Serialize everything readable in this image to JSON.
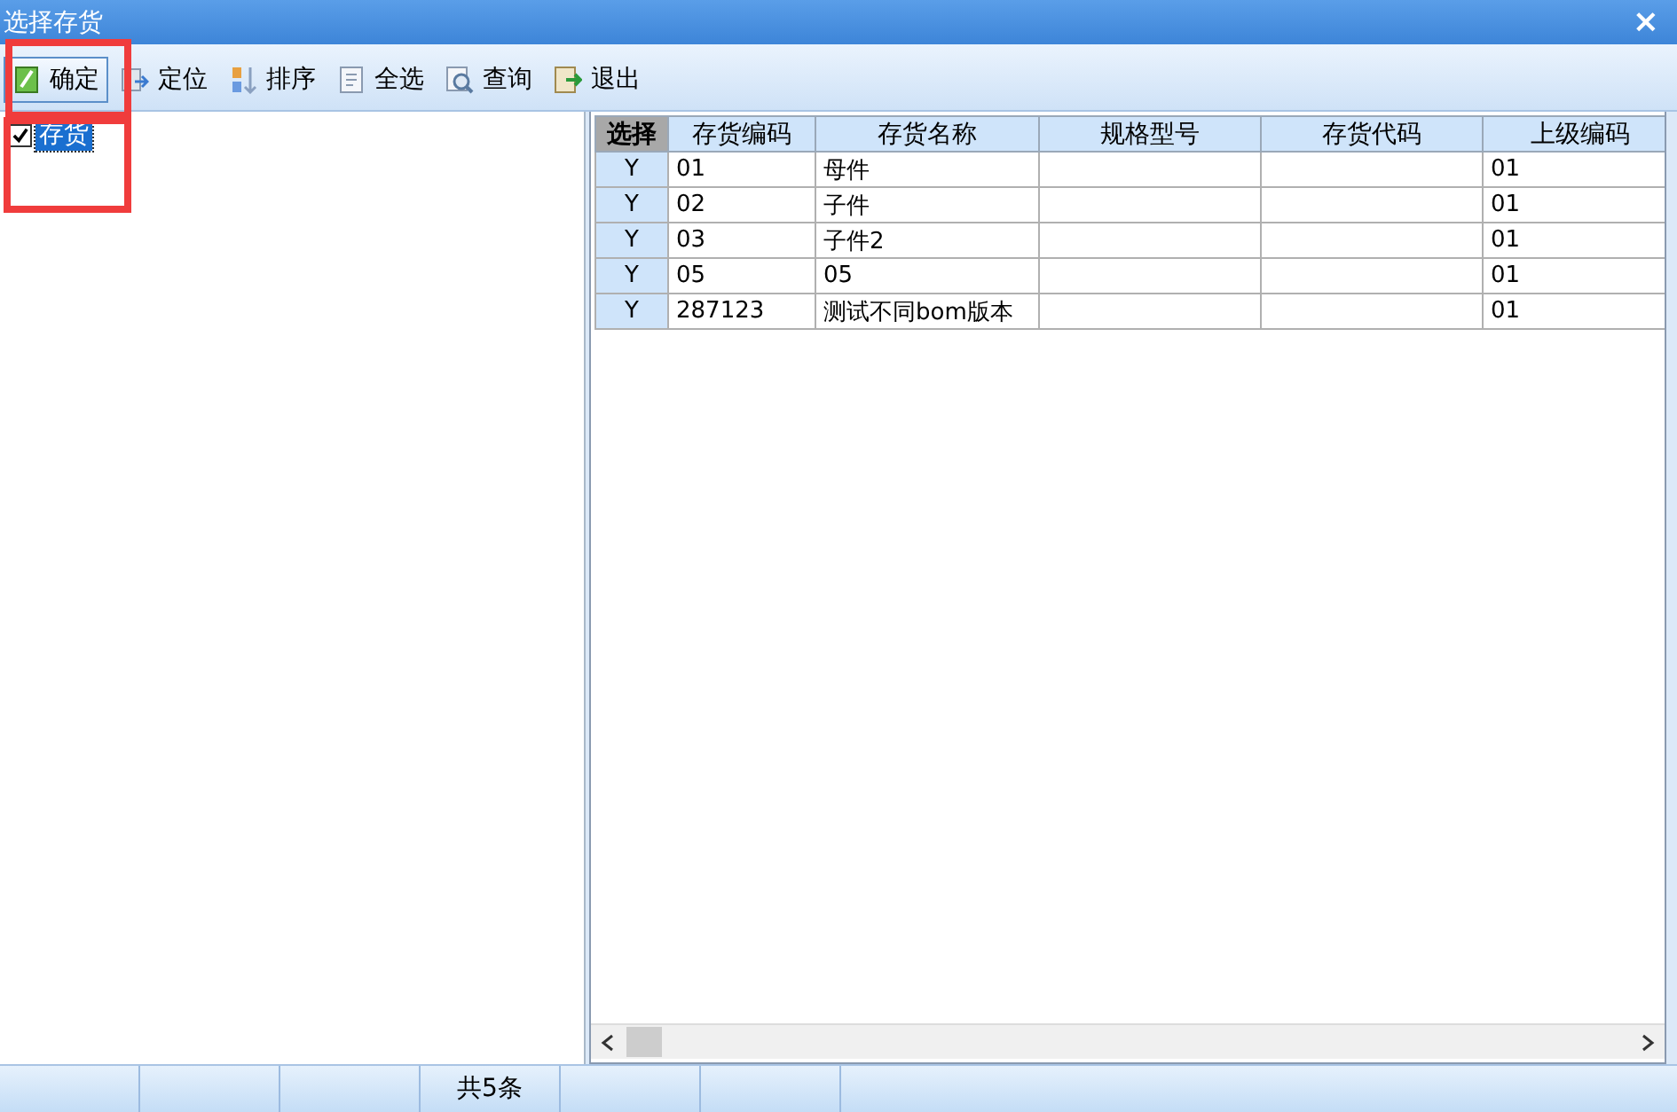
{
  "window": {
    "title": "选择存货",
    "close": "×"
  },
  "toolbar": [
    {
      "kind": "confirm",
      "label": "确定",
      "pressed": true
    },
    {
      "kind": "locate",
      "label": "定位",
      "pressed": false
    },
    {
      "kind": "sort",
      "label": "排序",
      "pressed": false
    },
    {
      "kind": "select-all",
      "label": "全选",
      "pressed": false
    },
    {
      "kind": "query",
      "label": "查询",
      "pressed": false
    },
    {
      "kind": "exit",
      "label": "退出",
      "pressed": false
    }
  ],
  "tree": {
    "items": [
      {
        "label": "存货",
        "checked": true,
        "selected": true
      }
    ]
  },
  "table": {
    "columns": [
      "选择",
      "存货编码",
      "存货名称",
      "规格型号",
      "存货代码",
      "上级编码"
    ],
    "rows": [
      [
        "Y",
        "01",
        "母件",
        "",
        "",
        "01"
      ],
      [
        "Y",
        "02",
        "子件",
        "",
        "",
        "01"
      ],
      [
        "Y",
        "03",
        "子件2",
        "",
        "",
        "01"
      ],
      [
        "Y",
        "05",
        "05",
        "",
        "",
        "01"
      ],
      [
        "Y",
        "287123",
        "测试不同bom版本",
        "",
        "",
        "01"
      ]
    ]
  },
  "status_bar": {
    "count": "共5条"
  }
}
